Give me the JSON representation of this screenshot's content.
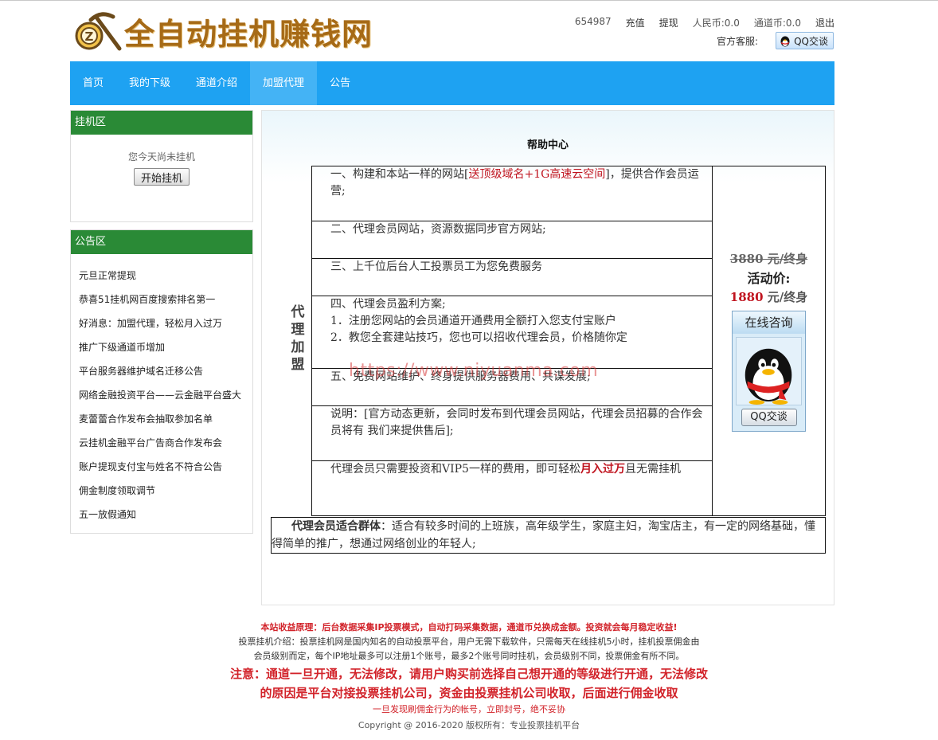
{
  "site": {
    "logo_text": "全自动挂机赚钱网",
    "logo_icon": "pickaxe-coin-icon",
    "accent_color": "#1ea2f2",
    "panel_header_color": "#2a8a36",
    "highlight_color": "#c0141f"
  },
  "userbar": {
    "user_id": "654987",
    "recharge": "充值",
    "withdraw": "提现",
    "rmb_balance": "人民币:0.0",
    "channel_balance": "通道币:0.0",
    "logout": "退出"
  },
  "service": {
    "label": "官方客服:",
    "qq_button": "QQ交谈"
  },
  "nav": {
    "items": [
      "首页",
      "我的下级",
      "通道介绍",
      "加盟代理",
      "公告"
    ],
    "active": "加盟代理"
  },
  "hang_panel": {
    "title": "挂机区",
    "status": "您今天尚未挂机",
    "start_button": "开始挂机"
  },
  "notice_panel": {
    "title": "公告区",
    "items": [
      "元旦正常提现",
      "恭喜51挂机网百度搜索排名第一",
      "好消息：加盟代理，轻松月入过万",
      "推广下级通道币增加",
      "平台服务器维护域名迁移公告",
      "网络金融投资平台——云金融平台盛大",
      "麦蕾蕾合作发布会抽取参加名单",
      "云挂机金融平台广告商合作发布会",
      "账户提现支付宝与姓名不符合公告",
      "佣金制度领取调节",
      "五一放假通知"
    ]
  },
  "main": {
    "title": "帮助中心",
    "side_label": "代理加盟",
    "rows": {
      "r1_a": "一、构建和本站一样的网站[",
      "r1_red": "送顶级域名+1G高速云空间",
      "r1_b": "]，提供合作会员运营;",
      "r2": "二、代理会员网站，资源数据同步官方网站;",
      "r3": "三、上千位后台人工投票员工为您免费服务",
      "r4_title": "四、代理会员盈利方案;",
      "r4_item1": "1．注册您网站的会员通道开通费用全额打入您支付宝账户",
      "r4_item2": "2．教您全套建站技巧，您也可以招收代理会员，价格随你定",
      "r5": "五、免费网站维护、终身提供服务器费用、共谋发展;",
      "r6": "说明：[官方动态更新，会同时发布到代理会员网站，代理会员招募的合作会员将有 我们来提供售后];",
      "r7_a": "代理会员只需要投资和VIP5一样的费用，即可轻松",
      "r7_red": "月入过万",
      "r7_b": "且无需挂机"
    },
    "price": {
      "old": "3880 元/终身",
      "activity_label": "活动价:",
      "new_value": "1880",
      "new_unit": " 元/终身"
    },
    "consult": {
      "title": "在线咨询",
      "button": "QQ交谈"
    },
    "crowd": {
      "label": "代理会员适合群体",
      "text": "：适合有较多时间的上班族，高年级学生，家庭主妇，淘宝店主，有一定的网络基础，懂得简单的推广，想通过网络创业的年轻人;"
    },
    "watermark": "https://www.niyuanma.com"
  },
  "footer": {
    "line1": "本站收益原理：后台数据采集IP投票模式，自动打码采集数据，通道币兑换成金额。投资就会每月稳定收益!",
    "line2": "投票挂机介绍：投票挂机网是国内知名的自动投票平台，用户无需下载软件，只需每天在线挂机5小时，挂机投票佣金由",
    "line3": "会员级别而定，每个IP地址最多可以注册1个账号，最多2个账号同时挂机，会员级别不同，投票佣金有所不同。",
    "line4": "注意：通道一旦开通，无法修改，请用户购买前选择自己想开通的等级进行开通，无法修改",
    "line5": "的原因是平台对接投票挂机公司，资金由投票挂机公司收取，后面进行佣金收取",
    "line6": "一旦发现刷佣金行为的帐号，立即封号，绝不妥协",
    "line7": "Copyright @ 2016-2020   版权所有：专业投票挂机平台"
  }
}
